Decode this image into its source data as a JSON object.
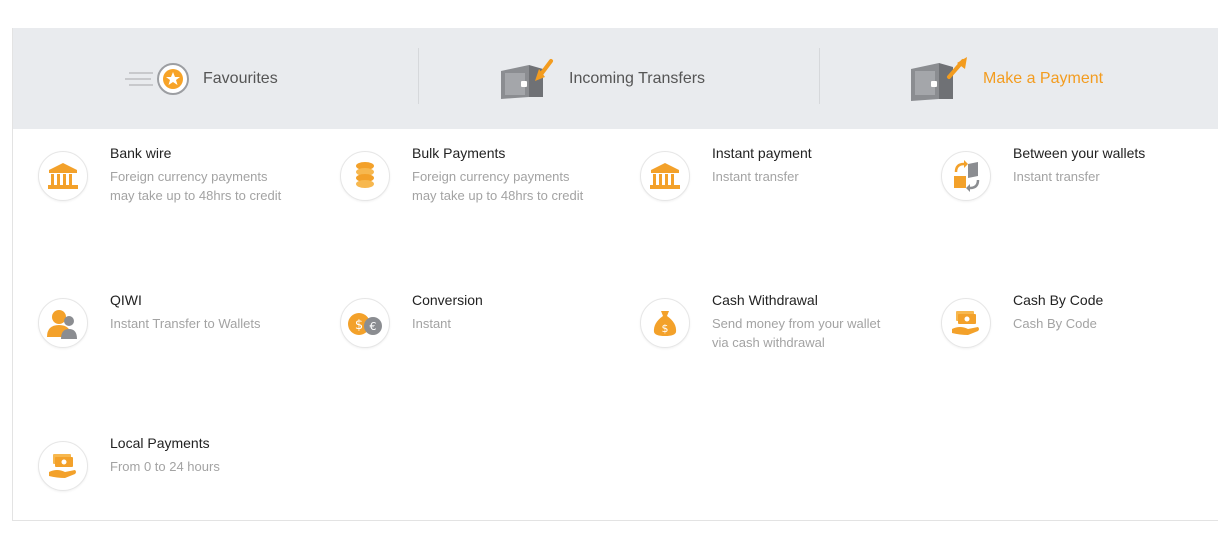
{
  "tabs": [
    {
      "label": "Favourites",
      "icon": "star-circle-icon"
    },
    {
      "label": "Incoming Transfers",
      "icon": "wallet-incoming-icon"
    },
    {
      "label": "Make a Payment",
      "icon": "wallet-outgoing-icon",
      "active": true
    }
  ],
  "colors": {
    "accent": "#f39c1f",
    "tab_bg": "#e9ebee",
    "desc": "#a3a3a3"
  },
  "payment_methods": [
    {
      "title": "Bank wire",
      "desc": "Foreign currency payments may take up to 48hrs to credit",
      "icon": "bank-icon"
    },
    {
      "title": "Bulk Payments",
      "desc": "Foreign currency payments may take up to 48hrs to credit",
      "icon": "coin-stack-icon"
    },
    {
      "title": "Instant payment",
      "desc": "Instant transfer",
      "icon": "bank-icon"
    },
    {
      "title": "Between your wallets",
      "desc": "Instant transfer",
      "icon": "wallets-exchange-icon"
    },
    {
      "title": "QIWI",
      "desc": "Instant Transfer to Wallets",
      "icon": "users-icon"
    },
    {
      "title": "Conversion",
      "desc": "Instant",
      "icon": "currency-exchange-icon"
    },
    {
      "title": "Cash Withdrawal",
      "desc": "Send money from your wallet via cash withdrawal",
      "icon": "money-bag-icon"
    },
    {
      "title": "Cash By Code",
      "desc": "Cash By Code",
      "icon": "cash-hand-icon"
    },
    {
      "title": "Local Payments",
      "desc": "From 0 to 24 hours",
      "icon": "cash-hand-icon"
    }
  ]
}
